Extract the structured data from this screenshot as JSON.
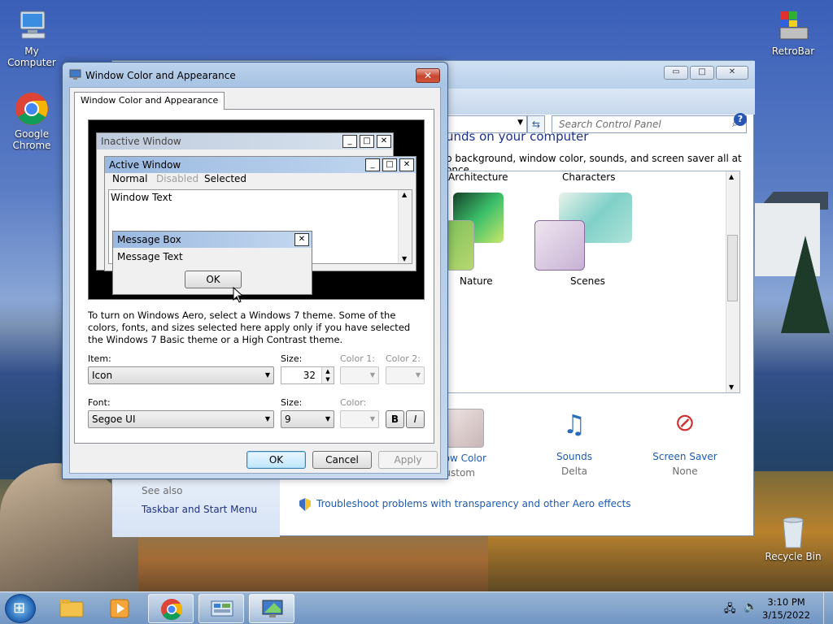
{
  "desktop": {
    "icons": [
      {
        "label": "My Computer"
      },
      {
        "label": "Google\nChrome"
      },
      {
        "label": "RetroBar"
      },
      {
        "label": "Recycle Bin"
      }
    ]
  },
  "control_panel": {
    "search_placeholder": "Search Control Panel",
    "heading": "unds on your computer",
    "subheading": "p background, window color, sounds, and screen saver all at once.",
    "themes": [
      {
        "label": "Architecture"
      },
      {
        "label": "Characters"
      },
      {
        "label": "Nature"
      },
      {
        "label": "Scenes"
      }
    ],
    "bottom_items": [
      {
        "label": "dow Color",
        "value": "Custom"
      },
      {
        "label": "Sounds",
        "value": "Delta"
      },
      {
        "label": "Screen Saver",
        "value": "None"
      }
    ],
    "see_also": "See also",
    "see_also_link": "Taskbar and Start Menu",
    "troubleshoot_link": "Troubleshoot problems with transparency and other Aero effects",
    "window_buttons": {
      "minimize": "▭",
      "maximize": "□",
      "close": "✕"
    }
  },
  "dialog": {
    "title": "Window Color and Appearance",
    "tab_label": "Window Color and Appearance",
    "preview": {
      "inactive_title": "Inactive Window",
      "active_title": "Active Window",
      "menu": [
        "Normal",
        "Disabled",
        "Selected"
      ],
      "window_text": "Window Text",
      "message_box_title": "Message Box",
      "message_text": "Message Text",
      "ok_label": "OK"
    },
    "description": "To turn on Windows Aero, select a Windows 7 theme.  Some of the colors, fonts, and sizes selected here apply only if you have selected the Windows 7 Basic theme or a High Contrast theme.",
    "item_label": "Item:",
    "item_value": "Icon",
    "size_label": "Size:",
    "size_value": "32",
    "color1_label": "Color 1:",
    "color2_label": "Color 2:",
    "font_label": "Font:",
    "font_value": "Segoe UI",
    "font_size_label": "Size:",
    "font_size_value": "9",
    "font_color_label": "Color:",
    "bold_label": "B",
    "italic_label": "I",
    "ok": "OK",
    "cancel": "Cancel",
    "apply": "Apply"
  },
  "taskbar": {
    "time": "3:10 PM",
    "date": "3/15/2022"
  }
}
